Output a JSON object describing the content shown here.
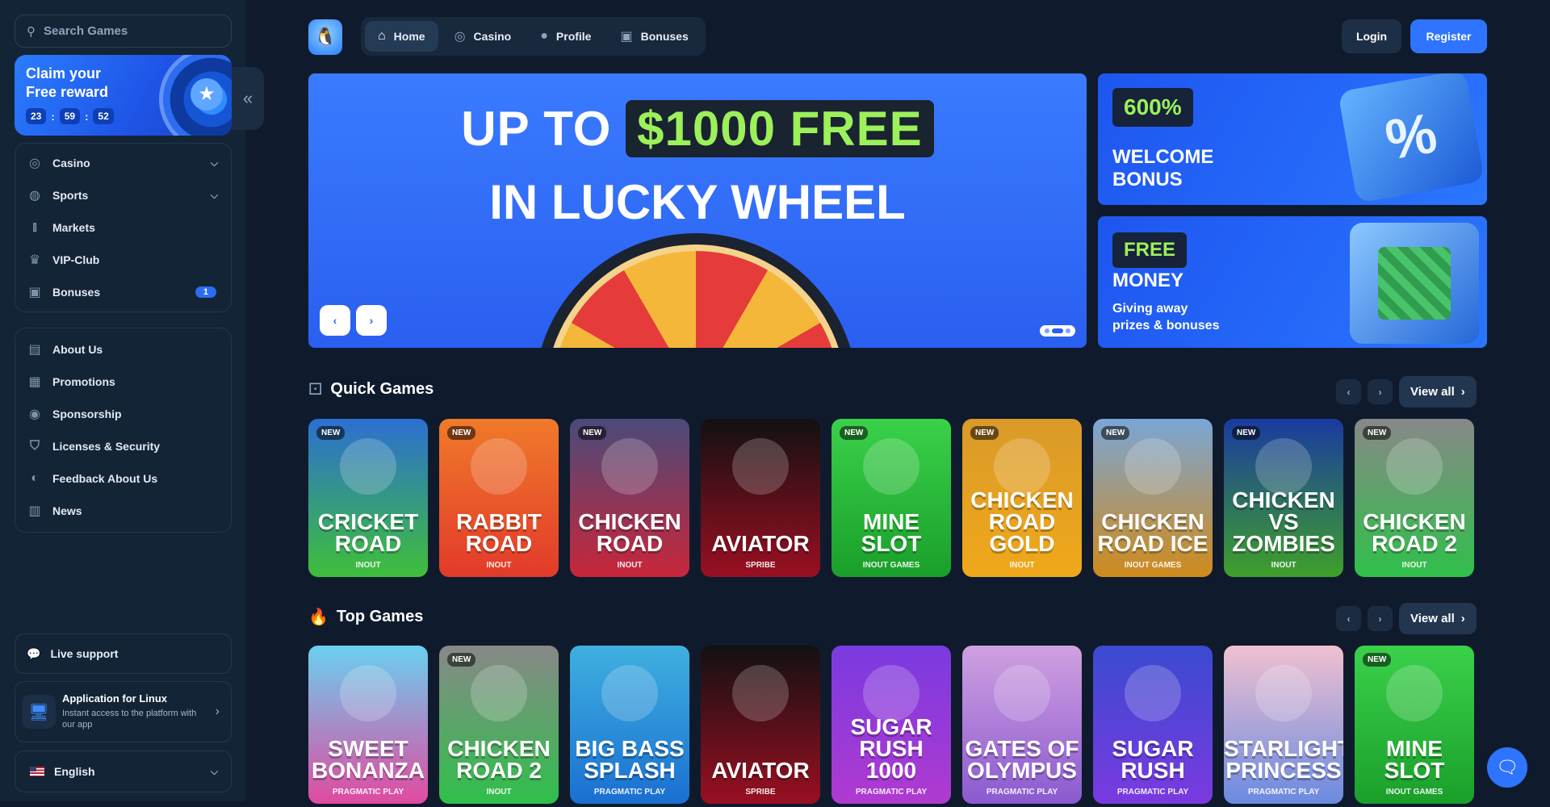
{
  "search": {
    "placeholder": "Search Games"
  },
  "reward": {
    "title_line1": "Claim your",
    "title_line2": "Free reward",
    "hours": "23",
    "minutes": "59",
    "seconds": "52"
  },
  "nav_main": [
    {
      "label": "Casino",
      "icon": "casino-chip-icon",
      "expandable": true
    },
    {
      "label": "Sports",
      "icon": "globe-icon",
      "expandable": true
    },
    {
      "label": "Markets",
      "icon": "candlestick-icon",
      "expandable": false
    },
    {
      "label": "VIP-Club",
      "icon": "crown-icon",
      "expandable": false
    },
    {
      "label": "Bonuses",
      "icon": "gift-icon",
      "badge": "1"
    }
  ],
  "nav_info": [
    {
      "label": "About Us",
      "icon": "book-icon"
    },
    {
      "label": "Promotions",
      "icon": "ticket-icon"
    },
    {
      "label": "Sponsorship",
      "icon": "medal-icon"
    },
    {
      "label": "Licenses & Security",
      "icon": "shield-icon"
    },
    {
      "label": "Feedback About Us",
      "icon": "chat-icon"
    },
    {
      "label": "News",
      "icon": "news-icon"
    }
  ],
  "support": {
    "label": "Live support"
  },
  "app": {
    "title": "Application for Linux",
    "subtitle": "Instant access to the platform with our app"
  },
  "language": {
    "label": "English"
  },
  "topnav": {
    "tabs": [
      {
        "label": "Home",
        "icon": "home-icon",
        "active": true
      },
      {
        "label": "Casino",
        "icon": "casino-chip-icon",
        "active": false
      },
      {
        "label": "Profile",
        "icon": "user-icon",
        "active": false
      },
      {
        "label": "Bonuses",
        "icon": "gift-icon",
        "active": false
      }
    ],
    "login": "Login",
    "register": "Register"
  },
  "hero": {
    "line1_a": "UP TO",
    "line1_highlight": "$1000 FREE",
    "line2": "IN LUCKY WHEEL"
  },
  "promo1": {
    "pill": "600%",
    "title_line1": "WELCOME",
    "title_line2": "BONUS"
  },
  "promo2": {
    "pill": "FREE",
    "title": "MONEY",
    "sub_line1": "Giving away",
    "sub_line2": "prizes & bonuses"
  },
  "quick_games": {
    "title": "Quick Games",
    "view_all": "View all",
    "games": [
      {
        "name_line1": "CRICKET",
        "name_line2": "ROAD",
        "provider": "INOUT",
        "new": true,
        "color_top": "#2c6fd1",
        "color_bottom": "#3fbf3a"
      },
      {
        "name_line1": "RABBIT",
        "name_line2": "ROAD",
        "provider": "INOUT",
        "new": true,
        "color_top": "#f07a2a",
        "color_bottom": "#e23a2a"
      },
      {
        "name_line1": "CHICKEN",
        "name_line2": "ROAD",
        "provider": "INOUT",
        "new": true,
        "color_top": "#4a4a7a",
        "color_bottom": "#c8263a"
      },
      {
        "name_line1": "AVIATOR",
        "name_line2": "",
        "provider": "SPRIBE",
        "new": false,
        "color_top": "#111111",
        "color_bottom": "#9a0f22"
      },
      {
        "name_line1": "MINE",
        "name_line2": "SLOT",
        "provider": "INOUT GAMES",
        "new": true,
        "color_top": "#3ad14a",
        "color_bottom": "#1a9f2a"
      },
      {
        "name_line1": "CHICKEN",
        "name_line2": "ROAD GOLD",
        "provider": "INOUT",
        "new": true,
        "color_top": "#d99a2a",
        "color_bottom": "#f0a81a"
      },
      {
        "name_line1": "CHICKEN",
        "name_line2": "ROAD ICE",
        "provider": "INOUT GAMES",
        "new": true,
        "color_top": "#7aa6d6",
        "color_bottom": "#d08a1a"
      },
      {
        "name_line1": "CHICKEN",
        "name_line2": "VS ZOMBIES",
        "provider": "INOUT",
        "new": true,
        "color_top": "#1a3aa0",
        "color_bottom": "#3fa02a"
      },
      {
        "name_line1": "CHICKEN",
        "name_line2": "ROAD 2",
        "provider": "INOUT",
        "new": true,
        "color_top": "#888888",
        "color_bottom": "#2fc04a"
      }
    ]
  },
  "top_games": {
    "title": "Top Games",
    "view_all": "View all",
    "games": [
      {
        "name_line1": "SWEET",
        "name_line2": "BONANZA",
        "provider": "PRAGMATIC PLAY",
        "new": false,
        "color_top": "#6ad0f0",
        "color_bottom": "#e04aa0"
      },
      {
        "name_line1": "CHICKEN",
        "name_line2": "ROAD 2",
        "provider": "INOUT",
        "new": true,
        "color_top": "#888888",
        "color_bottom": "#2fc04a"
      },
      {
        "name_line1": "BIG BASS",
        "name_line2": "SPLASH",
        "provider": "PRAGMATIC PLAY",
        "new": false,
        "color_top": "#3fb0e0",
        "color_bottom": "#1a6fd0"
      },
      {
        "name_line1": "AVIATOR",
        "name_line2": "",
        "provider": "SPRIBE",
        "new": false,
        "color_top": "#111111",
        "color_bottom": "#9a0f22"
      },
      {
        "name_line1": "SUGAR",
        "name_line2": "RUSH 1000",
        "provider": "PRAGMATIC PLAY",
        "new": false,
        "color_top": "#7a3ae0",
        "color_bottom": "#b03ad0"
      },
      {
        "name_line1": "GATES OF",
        "name_line2": "OLYMPUS",
        "provider": "PRAGMATIC PLAY",
        "new": false,
        "color_top": "#d0a0e0",
        "color_bottom": "#8a5ad0"
      },
      {
        "name_line1": "SUGAR",
        "name_line2": "RUSH",
        "provider": "PRAGMATIC PLAY",
        "new": false,
        "color_top": "#3a4ad0",
        "color_bottom": "#7a3ae0"
      },
      {
        "name_line1": "STARLIGHT",
        "name_line2": "PRINCESS",
        "provider": "PRAGMATIC PLAY",
        "new": false,
        "color_top": "#f0c0d0",
        "color_bottom": "#6a8ae0"
      },
      {
        "name_line1": "MINE",
        "name_line2": "SLOT",
        "provider": "INOUT GAMES",
        "new": true,
        "color_top": "#3ad14a",
        "color_bottom": "#1a9f2a"
      }
    ]
  }
}
